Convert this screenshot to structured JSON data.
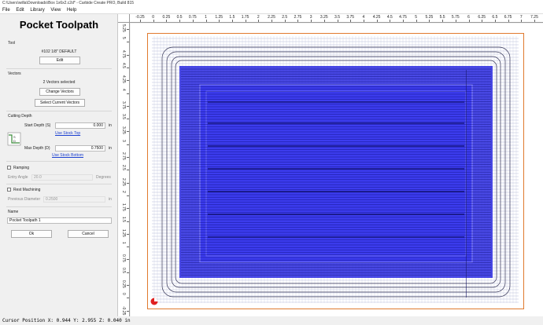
{
  "window": {
    "title": "C:\\Users\\willa\\Downloads\\Box 1x6x2.c2d* - Carbide Create PRO, Build 815"
  },
  "menu": [
    "File",
    "Edit",
    "Library",
    "View",
    "Help"
  ],
  "panel": {
    "title": "Pocket Toolpath",
    "tool": {
      "section": "Tool",
      "name": "#102 1/8\" DEFAULT",
      "edit_label": "Edit"
    },
    "vectors": {
      "section": "Vectors",
      "status": "2 Vectors selected",
      "change_label": "Change Vectors",
      "select_label": "Select Current Vectors"
    },
    "depth": {
      "section": "Cutting Depth",
      "start_label": "Start Depth (S)",
      "start_value": "0.000",
      "start_unit": "in",
      "stock_top_link": "Use Stock Top",
      "max_label": "Max Depth (D)",
      "max_value": "0.7500",
      "max_unit": "in",
      "stock_bottom_link": "Use Stock Bottom"
    },
    "ramping": {
      "label": "Ramping",
      "checked": false,
      "entry_label": "Entry Angle",
      "entry_value": "20.0",
      "entry_unit": "Degrees"
    },
    "rest": {
      "label": "Rest Machining",
      "checked": false,
      "prev_label": "Previous Diameter",
      "prev_value": "0.2500",
      "prev_unit": "in"
    },
    "name": {
      "section": "Name",
      "value": "Pocket Toolpath 1"
    },
    "ok_label": "Ok",
    "cancel_label": "Cancel"
  },
  "rulers": {
    "horizontal": [
      "-0.25",
      "0",
      "0.25",
      "0.5",
      "0.75",
      "1",
      "1.25",
      "1.5",
      "1.75",
      "2",
      "2.25",
      "2.5",
      "2.75",
      "3",
      "3.25",
      "3.5",
      "3.75",
      "4",
      "4.25",
      "4.5",
      "4.75",
      "5",
      "5.25",
      "5.5",
      "5.75",
      "6",
      "6.25",
      "6.5",
      "6.75",
      "7",
      "7.25"
    ],
    "vertical": [
      "5.25",
      "5",
      "4.75",
      "4.5",
      "4.25",
      "4",
      "3.75",
      "3.5",
      "3.25",
      "3",
      "2.75",
      "2.5",
      "2.25",
      "2",
      "1.75",
      "1.5",
      "1.25",
      "1",
      "0.75",
      "0.5",
      "0.25",
      "0",
      "-0.25"
    ]
  },
  "colors": {
    "pocket": "#2a2ae0",
    "toolpath": "#0a0a70",
    "stock": "#e07a2e",
    "origin": "#e02020"
  },
  "status": {
    "text": "Cursor Position X: 0.944 Y: 2.955 Z: 0.040 in"
  }
}
